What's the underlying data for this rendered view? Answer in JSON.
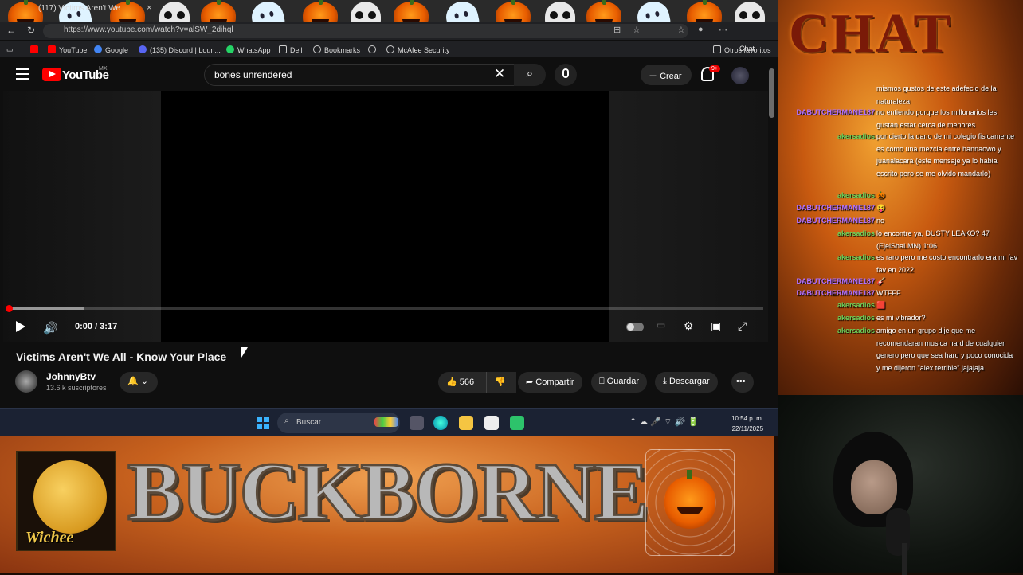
{
  "browser": {
    "tab_title": "(117) Victims Aren't We",
    "tab_close": "×",
    "chat_tab": "Chat",
    "url": "https://www.youtube.com/watch?v=alSW_2dihql",
    "bookmarks": [
      "YouTube",
      "Google",
      "(135) Discord | Loun...",
      "WhatsApp",
      "Dell",
      "Bookmarks",
      "McAfee Security"
    ],
    "other_favorites": "Otros favoritos"
  },
  "youtube": {
    "logo_text": "YouTube",
    "country_code": "MX",
    "search_query": "bones unrendered",
    "create_label": "Crear",
    "notif_count": "9+",
    "player": {
      "time": "0:00 / 3:17",
      "played_fraction": 0,
      "loaded_fraction": 0.1
    },
    "video_title": "Victims Aren't We All - Know Your Place",
    "channel_name": "JohnnyBtv",
    "subscribers": "13.6 k suscriptores",
    "likes": "566",
    "share_label": "Compartir",
    "save_label": "Guardar",
    "download_label": "Descargar",
    "more_label": "•••"
  },
  "taskbar": {
    "search_placeholder": "Buscar",
    "time": "10:54 p. m.",
    "date": "22/11/2025"
  },
  "banner": {
    "title": "BUCKBORNE",
    "logo_text": "Wichee"
  },
  "chat": {
    "header": "CHAT",
    "messages": [
      {
        "user": "",
        "text": "mismos gustos de este adefecio de la naturaleza",
        "color": "#ffffff"
      },
      {
        "user": "DABUTCHERMANE187",
        "text": "no entiendo porque los millonarios les gustan estar cerca de menores",
        "color": "#b070ff"
      },
      {
        "user": "akersadios",
        "text": "por cierto la dano de mi colegio fisicamente es como una mezcla entre hannaowo y juanalacara (este mensaje ya lo habia escrito pero se me olvido mandarlo)",
        "color": "#6ad05a"
      },
      {
        "user": "akersadios",
        "text": "🎃",
        "color": "#6ad05a"
      },
      {
        "user": "DABUTCHERMANE187",
        "text": "😝",
        "color": "#b070ff"
      },
      {
        "user": "DABUTCHERMANE187",
        "text": "no",
        "color": "#b070ff"
      },
      {
        "user": "akersadios",
        "text": "lo encontre ya, DUSTY LEAKO? 47 (EjelShaLMN) 1:06",
        "color": "#6ad05a"
      },
      {
        "user": "akersadios",
        "text": "es raro pero me costo encontrarlo era mi fav fav en 2022",
        "color": "#6ad05a"
      },
      {
        "user": "DABUTCHERMANE187",
        "text": "🎸",
        "color": "#b070ff"
      },
      {
        "user": "DABUTCHERMANE187",
        "text": "WTFFF",
        "color": "#b070ff"
      },
      {
        "user": "akersadios",
        "text": "🟥",
        "color": "#6ad05a"
      },
      {
        "user": "akersadios",
        "text": "es mi vibrador?",
        "color": "#6ad05a"
      },
      {
        "user": "akersadios",
        "text": "amigo en un grupo dije que me recomendaran musica hard de cualquier genero pero que sea hard y poco conocida y me dijeron \"alex terrible\" jajajaja",
        "color": "#6ad05a"
      }
    ]
  }
}
